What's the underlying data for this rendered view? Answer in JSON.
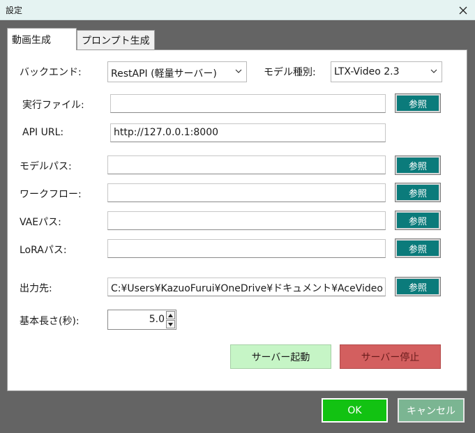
{
  "window": {
    "title": "設定"
  },
  "tabs": [
    {
      "label": "動画生成",
      "active": true
    },
    {
      "label": "プロンプト生成",
      "active": false
    }
  ],
  "form": {
    "backend": {
      "label": "バックエンド:",
      "value": "RestAPI (軽量サーバー)"
    },
    "model_type": {
      "label": "モデル種別:",
      "value": "LTX-Video 2.3"
    },
    "executable": {
      "label": "実行ファイル:",
      "value": ""
    },
    "api_url": {
      "label": "API URL:",
      "value": "http://127.0.0.1:8000"
    },
    "model_path": {
      "label": "モデルパス:",
      "value": ""
    },
    "workflow": {
      "label": "ワークフロー:",
      "value": ""
    },
    "vae_path": {
      "label": "VAEパス:",
      "value": ""
    },
    "lora_path": {
      "label": "LoRAパス:",
      "value": ""
    },
    "output_dir": {
      "label": "出力先:",
      "value": "C:¥Users¥KazuoFurui¥OneDrive¥ドキュメント¥AceVideo"
    },
    "base_length": {
      "label": "基本長さ(秒):",
      "value": "5.0"
    },
    "browse_label": "参照"
  },
  "server": {
    "start_label": "サーバー起動",
    "stop_label": "サーバー停止"
  },
  "footer": {
    "ok_label": "OK",
    "cancel_label": "キャンセル"
  },
  "colors": {
    "accent_teal": "#0b7b7b",
    "ok_green": "#12c212",
    "start_green": "#c6f5c6",
    "stop_red": "#d35f5f",
    "cancel_green": "#7bb592"
  }
}
